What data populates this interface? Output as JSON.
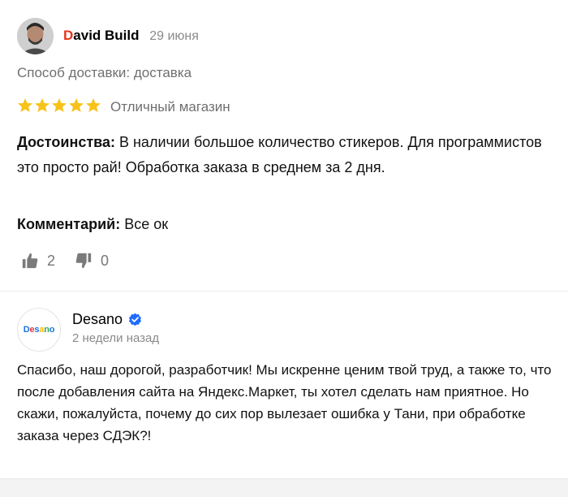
{
  "review": {
    "author": {
      "first_letter": "D",
      "rest": "avid Build"
    },
    "date": "29 июня",
    "delivery": "Способ доставки: доставка",
    "rating": {
      "stars": 5,
      "max": 5,
      "text": "Отличный магазин",
      "star_color": "#f7c31b"
    },
    "pros": {
      "label": "Достоинства:",
      "text": " В наличии большое количество стикеров. Для программистов это просто рай! Обработка заказа в среднем за 2 дня."
    },
    "comment": {
      "label": "Комментарий:",
      "text": " Все ок"
    },
    "votes": {
      "likes": "2",
      "dislikes": "0"
    }
  },
  "reply": {
    "shop_name": "Desano",
    "shop_logo_text": [
      "D",
      "e",
      "s",
      "a",
      "n",
      "o"
    ],
    "shop_logo_colors": [
      "#1a73e8",
      "#e53935",
      "#1a73e8",
      "#fbbc05",
      "#34a853",
      "#1a73e8"
    ],
    "time": "2 недели назад",
    "text": "Спасибо, наш дорогой, разработчик! Мы искренне ценим твой труд, а также то, что после добавления сайта на Яндекс.Маркет, ты хотел сделать нам приятное. Но скажи, пожалуйста, почему до сих пор вылезает ошибка у Тани, при обработке заказа через СДЭК?!",
    "verified_color": "#1e6bff"
  }
}
